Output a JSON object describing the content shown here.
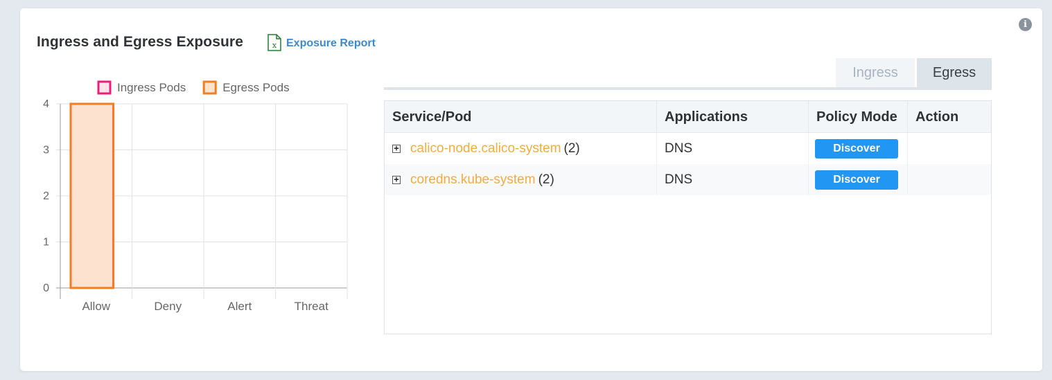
{
  "header": {
    "title": "Ingress and Egress Exposure",
    "report_label": "Exposure Report",
    "report_icon": "excel-file-icon",
    "info_icon": "info-circle-icon"
  },
  "chart_data": {
    "type": "bar",
    "categories": [
      "Allow",
      "Deny",
      "Alert",
      "Threat"
    ],
    "series": [
      {
        "name": "Ingress Pods",
        "values": [
          0,
          0,
          0,
          0
        ],
        "color": "#e91e7a",
        "fill": "#fde2ec"
      },
      {
        "name": "Egress Pods",
        "values": [
          4,
          0,
          0,
          0
        ],
        "color": "#f57c1f",
        "fill": "#fde3cf"
      }
    ],
    "ylim": [
      0,
      4
    ],
    "yticks": [
      "0",
      "1",
      "2",
      "3",
      "4"
    ],
    "grid": true,
    "legend": "top"
  },
  "tabs": [
    {
      "label": "Ingress",
      "active": false
    },
    {
      "label": "Egress",
      "active": true
    }
  ],
  "table": {
    "columns": [
      "Service/Pod",
      "Applications",
      "Policy Mode",
      "Action"
    ],
    "rows": [
      {
        "service": "calico-node.calico-system",
        "count": "(2)",
        "application": "DNS",
        "policy_mode": "Discover",
        "action": ""
      },
      {
        "service": "coredns.kube-system",
        "count": "(2)",
        "application": "DNS",
        "policy_mode": "Discover",
        "action": ""
      }
    ]
  },
  "colors": {
    "link": "#3b8ad0",
    "pod_link": "#f4ac3b",
    "discover": "#2196f3",
    "excel_green": "#1e7e34"
  }
}
